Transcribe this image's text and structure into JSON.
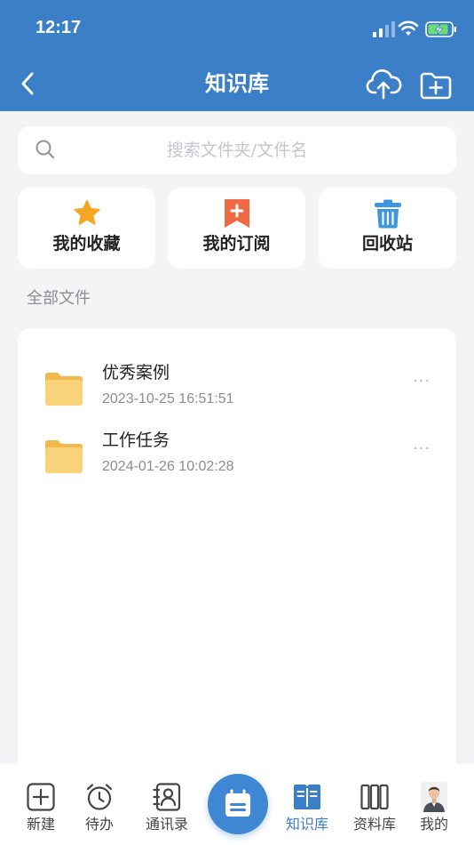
{
  "status_bar": {
    "time": "12:17"
  },
  "nav": {
    "title": "知识库"
  },
  "search": {
    "placeholder": "搜索文件夹/文件名"
  },
  "quick_actions": [
    {
      "label": "我的收藏",
      "icon": "star-icon",
      "color": "#f5a623"
    },
    {
      "label": "我的订阅",
      "icon": "bookmark-plus-icon",
      "color": "#ef6a42"
    },
    {
      "label": "回收站",
      "icon": "trash-icon",
      "color": "#3c97e0"
    }
  ],
  "section": {
    "title": "全部文件"
  },
  "files": [
    {
      "name": "优秀案例",
      "date": "2023-10-25 16:51:51",
      "more": "···"
    },
    {
      "name": "工作任务",
      "date": "2024-01-26 10:02:28",
      "more": "···"
    }
  ],
  "tabs": [
    {
      "label": "新建",
      "icon": "plus-square-icon"
    },
    {
      "label": "待办",
      "icon": "alarm-clock-icon"
    },
    {
      "label": "通讯录",
      "icon": "contacts-icon"
    },
    {
      "label": "知识库",
      "icon": "open-book-icon",
      "active": true
    },
    {
      "label": "资料库",
      "icon": "bookshelf-icon"
    },
    {
      "label": "我的",
      "icon": "avatar"
    }
  ],
  "colors": {
    "primary": "#3a7fc8",
    "background": "#f3f4f6",
    "folder": "#f7c95c"
  }
}
